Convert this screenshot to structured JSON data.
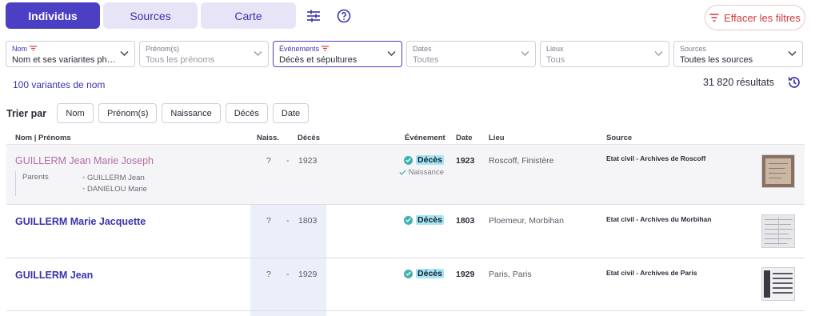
{
  "tabs": [
    {
      "label": "Individus",
      "active": true
    },
    {
      "label": "Sources",
      "active": false
    },
    {
      "label": "Carte",
      "active": false
    }
  ],
  "toolbar": {
    "settings_icon": "sliders-icon",
    "help_icon": "help-circle-icon",
    "clear_label": "Effacer les filtres"
  },
  "filters": [
    {
      "label": "Nom",
      "value": "Nom et ses variantes phoné…",
      "filtered": true,
      "set": true
    },
    {
      "label": "Prénom(s)",
      "value": "Tous les prénoms",
      "filtered": false,
      "set": false
    },
    {
      "label": "Événements",
      "value": "Décès et sépultures",
      "filtered": true,
      "set": true
    },
    {
      "label": "Dates",
      "value": "Toutes",
      "filtered": false,
      "set": false
    },
    {
      "label": "Lieux",
      "value": "Tous",
      "filtered": false,
      "set": false
    },
    {
      "label": "Sources",
      "value": "Toutes les sources",
      "filtered": false,
      "set": true
    }
  ],
  "summary": {
    "variants": "100 variantes de nom",
    "results": "31 820 résultats"
  },
  "sort": {
    "title": "Trier par",
    "options": [
      "Nom",
      "Prénom(s)",
      "Naissance",
      "Décès",
      "Date"
    ]
  },
  "table": {
    "headers": {
      "name": "Nom | Prénoms",
      "birth": "Naiss.",
      "death": "Décès",
      "event": "Événement",
      "date": "Date",
      "place": "Lieu",
      "source": "Source"
    },
    "rows": [
      {
        "name": "GUILLERM Jean Marie Joseph",
        "birth": "?",
        "sep": "-",
        "death": "1923",
        "event": "Décès",
        "sub_event": "Naissance",
        "date": "1923",
        "place": "Roscoff, Finistère",
        "source": "Etat civil - Archives de Roscoff",
        "parents_label": "Parents",
        "parents": [
          "GUILLERM Jean",
          "DANIELOU Marie"
        ]
      },
      {
        "name": "GUILLERM Marie Jacquette",
        "birth": "?",
        "sep": "-",
        "death": "1803",
        "event": "Décès",
        "date": "1803",
        "place": "Ploemeur, Morbihan",
        "source": "Etat civil - Archives du Morbihan"
      },
      {
        "name": "GUILLERM Jean",
        "birth": "?",
        "sep": "-",
        "death": "1929",
        "event": "Décès",
        "date": "1929",
        "place": "Paris, Paris",
        "source": "Etat civil - Archives de Paris"
      }
    ]
  },
  "colors": {
    "accent": "#4b3fc4",
    "clear": "#d33a3a",
    "event_check": "#3db3b0",
    "event_pill": "#a4e6f3"
  }
}
